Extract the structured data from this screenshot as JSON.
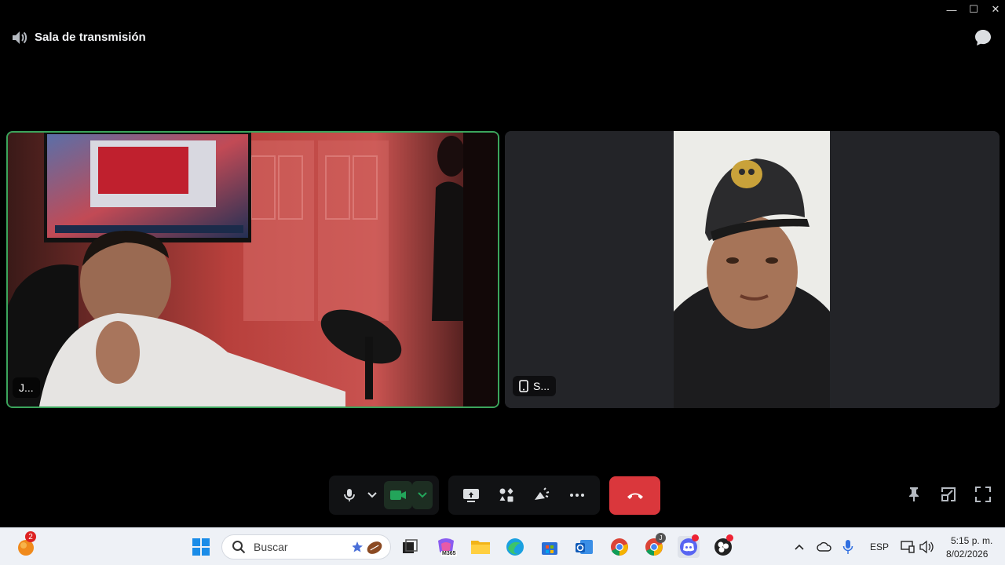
{
  "window": {
    "controls": {
      "minimize": "—",
      "maximize": "☐",
      "close": "✕"
    }
  },
  "header": {
    "title": "Sala de transmisión",
    "icons": {
      "channel": "speaker-icon",
      "chat": "chat-bubble-icon"
    }
  },
  "participants": [
    {
      "label": "J...",
      "speaking": true,
      "device": "desktop"
    },
    {
      "label": "S...",
      "speaking": false,
      "device": "mobile",
      "icon": "mobile-phone-icon"
    }
  ],
  "controls": {
    "mic": "microphone-icon",
    "camera": "camera-icon",
    "share": "screen-share-icon",
    "activities": "activities-icon",
    "soundboard": "soundboard-icon",
    "more": "more-icon",
    "disconnect": "hangup-icon",
    "pin": "pin-icon",
    "popout": "popout-icon",
    "fullscreen": "fullscreen-icon"
  },
  "colors": {
    "speaking_border": "#3ba55c",
    "hangup": "#da373c",
    "camera_active": "#23a55a"
  },
  "taskbar": {
    "search_placeholder": "Buscar",
    "widget_badge": "2",
    "copilot_label": "M365",
    "language": "ESP",
    "time": "5:15 p. m.",
    "date": "8/02/2026",
    "chrome_profile_badge": "J"
  }
}
